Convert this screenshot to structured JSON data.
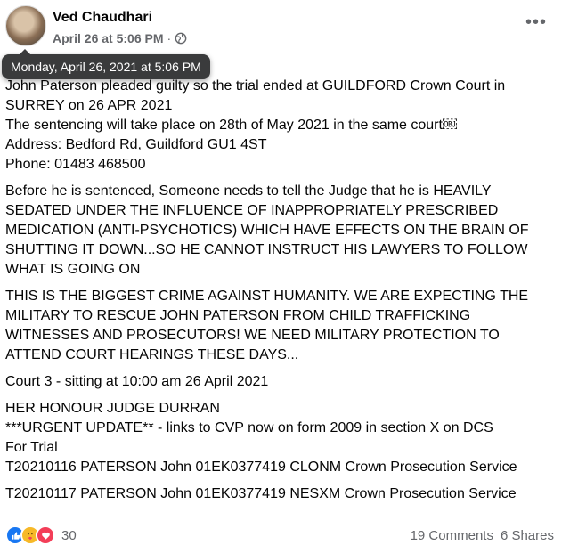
{
  "post": {
    "author": "Ved Chaudhari",
    "date": "April 26 at 5:06 PM",
    "separator": "·",
    "tooltip": "Monday, April 26, 2021 at 5:06 PM",
    "more_label": "•••"
  },
  "body": {
    "p1": [
      "John Paterson pleaded guilty so the trial ended at GUILDFORD Crown Court in",
      "SURREY on 26 APR 2021",
      "The sentencing will take place on 28th of May 2021 in the same court￼",
      "Address: Bedford Rd, Guildford GU1 4ST",
      "Phone: 01483 468500"
    ],
    "p2": [
      "Before he is sentenced, Someone needs to tell the Judge that he is HEAVILY",
      "SEDATED UNDER THE INFLUENCE OF INAPPROPRIATELY PRESCRIBED",
      "MEDICATION (ANTI-PSYCHOTICS) WHICH HAVE EFFECTS ON THE BRAIN OF",
      "SHUTTING IT DOWN...SO HE CANNOT INSTRUCT HIS LAWYERS TO FOLLOW",
      "WHAT IS GOING ON"
    ],
    "p3": [
      "THIS IS THE BIGGEST CRIME AGAINST HUMANITY.  WE ARE EXPECTING THE",
      "MILITARY TO RESCUE JOHN PATERSON FROM CHILD TRAFFICKING",
      "WITNESSES AND PROSECUTORS!  WE NEED MILITARY PROTECTION TO",
      "ATTEND COURT HEARINGS THESE DAYS..."
    ],
    "p4": [
      "Court 3 - sitting at 10:00 am 26 April 2021"
    ],
    "p5": [
      "HER HONOUR JUDGE DURRAN",
      "***URGENT UPDATE** - links to CVP now on form 2009 in section X on DCS",
      "For Trial",
      "T20210116  PATERSON John  01EK0377419  CLONM  Crown Prosecution Service"
    ],
    "p6": [
      "T20210117  PATERSON John  01EK0377419  NESXM  Crown Prosecution Service"
    ]
  },
  "footer": {
    "reaction_count": "30",
    "comments": "19 Comments",
    "shares": "6 Shares",
    "reaction_icons": [
      "like-icon",
      "care-icon",
      "love-icon"
    ]
  },
  "colors": {
    "secondary_text": "#65676b",
    "like": "#1877f2",
    "care": "#f7b928",
    "love": "#f33e58",
    "tooltip_bg": "#3a3b3c"
  }
}
